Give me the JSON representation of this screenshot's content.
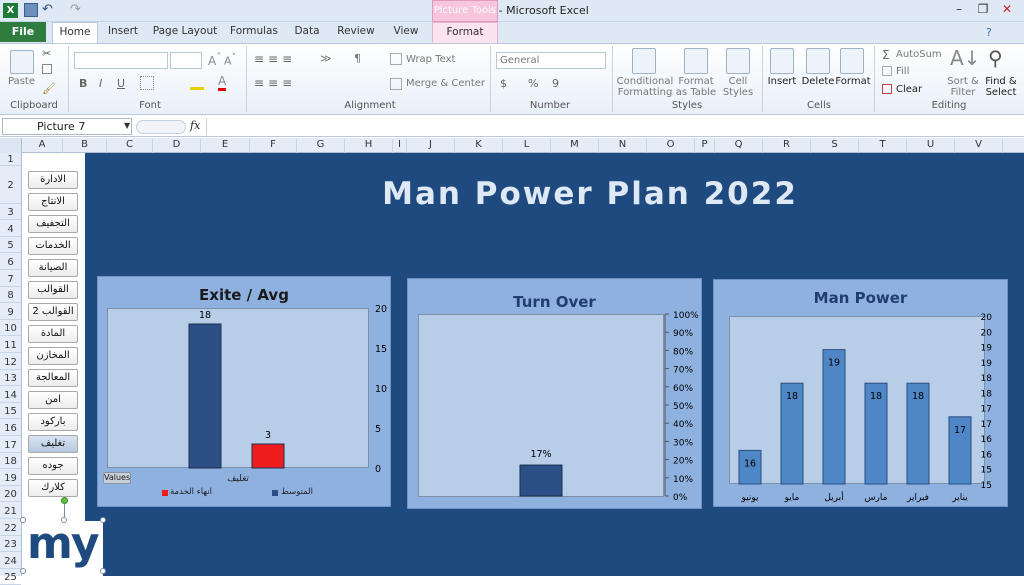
{
  "window": {
    "title": "Man Power  -  Microsoft Excel",
    "context_tab_group": "Picture Tools"
  },
  "tabs": [
    "File",
    "Home",
    "Insert",
    "Page Layout",
    "Formulas",
    "Data",
    "Review",
    "View",
    "Format"
  ],
  "ribbon": {
    "clipboard": {
      "group": "Clipboard",
      "paste": "Paste"
    },
    "font": {
      "group": "Font",
      "bold": "B",
      "italic": "I",
      "underline": "U"
    },
    "alignment": {
      "group": "Alignment",
      "wrap": "Wrap Text",
      "merge": "Merge & Center"
    },
    "number": {
      "group": "Number",
      "format": "General",
      "currency": "$",
      "percent": "%",
      "comma": "9"
    },
    "styles": {
      "group": "Styles",
      "conditional": "Conditional Formatting",
      "format_table": "Format as Table",
      "cell_styles": "Cell Styles"
    },
    "cells": {
      "group": "Cells",
      "insert": "Insert",
      "delete": "Delete",
      "format": "Format"
    },
    "editing": {
      "group": "Editing",
      "autosum": "AutoSum",
      "fill": "Fill",
      "clear": "Clear",
      "sort": "Sort & Filter",
      "find": "Find & Select"
    }
  },
  "formula_bar": {
    "name_box": "Picture 7",
    "fx": "fx",
    "value": ""
  },
  "columns": [
    "A",
    "B",
    "C",
    "D",
    "E",
    "F",
    "G",
    "H",
    "I",
    "J",
    "K",
    "L",
    "M",
    "N",
    "O",
    "P",
    "Q",
    "R",
    "S",
    "T",
    "U",
    "V"
  ],
  "rows": [
    "1",
    "2",
    "3",
    "4",
    "5",
    "6",
    "7",
    "8",
    "9",
    "10",
    "11",
    "12",
    "13",
    "14",
    "15",
    "16",
    "17",
    "18",
    "19",
    "20",
    "21",
    "22",
    "23",
    "24",
    "25"
  ],
  "departments": [
    "الادارة",
    "الانتاج",
    "التجفيف",
    "الخدمات",
    "الصيانة",
    "القوالب",
    "القوالب 2",
    "المادة",
    "المخازن",
    "المعالجة",
    "امن",
    "باركود",
    "تغليف",
    "جوده",
    "كلارك"
  ],
  "selected_department": "تغليف",
  "dashboard_title": "Man Power Plan 2022",
  "logo_text": "my",
  "chart_data": [
    {
      "type": "bar",
      "title": "Exite / Avg",
      "categories": [
        "تغليف"
      ],
      "series": [
        {
          "name": "المتوسط",
          "values": [
            18
          ],
          "color": "#2c5085"
        },
        {
          "name": "انهاء الخدمة",
          "values": [
            3
          ],
          "color": "#ee1c1c"
        }
      ],
      "ylim": [
        0,
        20
      ],
      "yticks": [
        "0",
        "5",
        "10",
        "15",
        "20"
      ],
      "field_button": "Values",
      "legend": "bottom"
    },
    {
      "type": "bar",
      "title": "Turn Over",
      "values": [
        0.17
      ],
      "data_labels": [
        "17%"
      ],
      "ylim": [
        0,
        1
      ],
      "yticks": [
        "0%",
        "10%",
        "20%",
        "30%",
        "40%",
        "50%",
        "60%",
        "70%",
        "80%",
        "90%",
        "100%"
      ],
      "color": "#2c5085"
    },
    {
      "type": "bar",
      "title": "Man Power",
      "categories": [
        "يونيو",
        "مايو",
        "أبريل",
        "مارس",
        "فبراير",
        "يناير"
      ],
      "values": [
        16,
        18,
        19,
        18,
        18,
        17
      ],
      "ylim": [
        15,
        20
      ],
      "yticks": [
        "15",
        "15",
        "16",
        "16",
        "17",
        "17",
        "18",
        "18",
        "19",
        "19",
        "20",
        "20"
      ],
      "color": "#4f86c6"
    }
  ]
}
